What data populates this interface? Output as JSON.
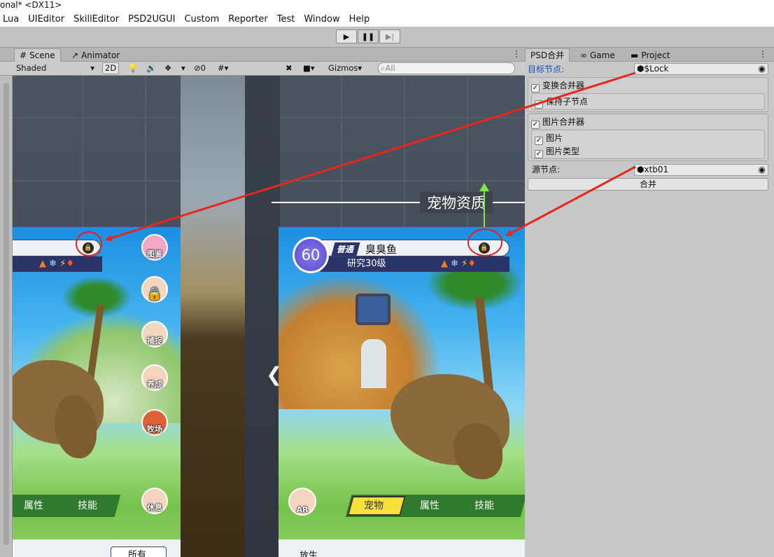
{
  "window_title": "onal* <DX11>",
  "menu": [
    "Lua",
    "UIEditor",
    "SkillEditor",
    "PSD2UGUI",
    "Custom",
    "Reporter",
    "Test",
    "Window",
    "Help"
  ],
  "play": {
    "play": "▶",
    "pause": "❚❚",
    "step": "▶|"
  },
  "scene_tabs": [
    {
      "icon": "#",
      "label": "Scene"
    },
    {
      "icon": "↗",
      "label": "Animator"
    }
  ],
  "scene_toolbar": {
    "shading": "Shaded",
    "mode2d": "2D",
    "hidden": "0",
    "gizmos": "Gizmos",
    "search_placeholder": "All"
  },
  "right_tabs": [
    {
      "label": "PSD合并"
    },
    {
      "icon": "∞",
      "label": "Game"
    },
    {
      "icon": "▬",
      "label": "Project"
    }
  ],
  "psd": {
    "target_label": "目标节点:",
    "target_value": "$Lock",
    "transform_merger": "变换合并器",
    "keep_children": "保持子节点",
    "image_merger": "图片合并器",
    "image": "图片",
    "image_type": "图片类型",
    "source_label": "源节点:",
    "source_value": "xtb01",
    "merge_button": "合并"
  },
  "scene_header": "宠物资质",
  "left_panel": {
    "side_icons": [
      "图鉴",
      "",
      "捕捉",
      "养成",
      "牧场",
      "休息"
    ],
    "bottom_tabs": [
      "属性",
      "技能"
    ],
    "bottom_text": "所有"
  },
  "right_game": {
    "level": "60",
    "rarity": "普通",
    "pet_name": "臭臭鱼",
    "research": "研究30级",
    "ar": "AR",
    "bottom_tabs": [
      "宠物",
      "属性",
      "技能"
    ],
    "bottom_text": "放生"
  },
  "colors": {
    "arrow": "#e8261c",
    "accent_tab": "#f7e13a"
  }
}
